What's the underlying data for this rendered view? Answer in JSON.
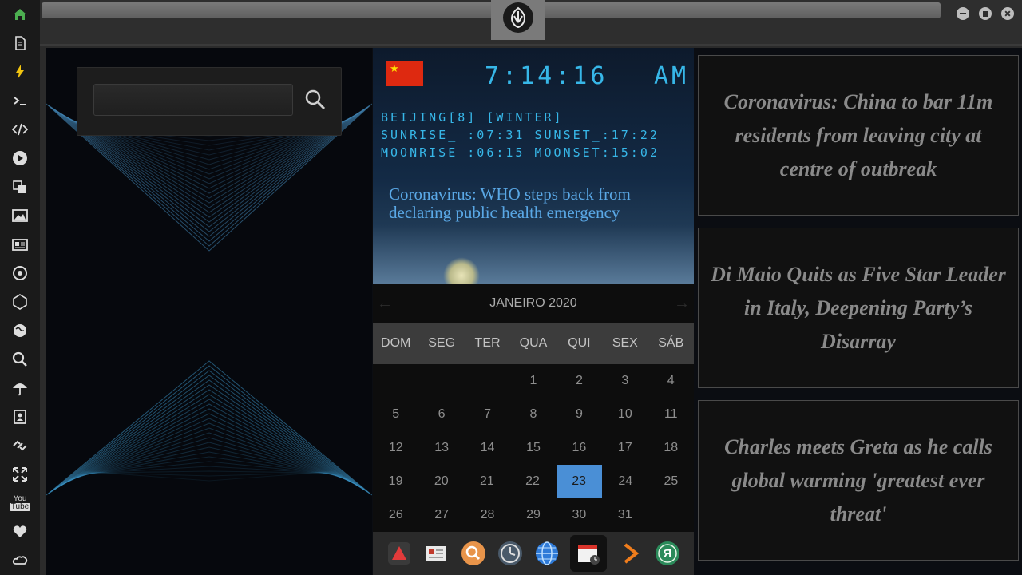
{
  "sidebar": {
    "icons": [
      "home-icon",
      "document-icon",
      "bolt-icon",
      "terminal-icon",
      "code-icon",
      "play-icon",
      "translate-icon",
      "image-icon",
      "news-icon",
      "rebel-icon",
      "network-icon",
      "globe-icon",
      "search-icon",
      "umbrella-icon",
      "contacts-icon",
      "link-icon",
      "expand-icon",
      "youtube-icon",
      "heart-icon",
      "cloud-icon"
    ],
    "youtube_label": "You Tube"
  },
  "weather": {
    "time": "7:14:16",
    "ampm": "AM",
    "location_line": "BEIJING[8] [WINTER]",
    "sun_line": "SUNRISE_ :07:31 SUNSET_:17:22",
    "moon_line": "MOONRISE :06:15 MOONSET:15:02",
    "headline": "Coronavirus: WHO steps back from declaring public health emergency",
    "flag_star": "★"
  },
  "calendar": {
    "prev": "←",
    "next": "→",
    "month": "JANEIRO 2020",
    "days_of_week": [
      "DOM",
      "SEG",
      "TER",
      "QUA",
      "QUI",
      "SEX",
      "SÁB"
    ],
    "weeks": [
      [
        "",
        "",
        "",
        "1",
        "2",
        "3",
        "4"
      ],
      [
        "5",
        "6",
        "7",
        "8",
        "9",
        "10",
        "11"
      ],
      [
        "12",
        "13",
        "14",
        "15",
        "16",
        "17",
        "18"
      ],
      [
        "19",
        "20",
        "21",
        "22",
        "23",
        "24",
        "25"
      ],
      [
        "26",
        "27",
        "28",
        "29",
        "30",
        "31",
        ""
      ]
    ],
    "today": "23"
  },
  "dock": {
    "items": [
      "app-a-icon",
      "news-reader-icon",
      "search-app-icon",
      "clock-app-icon",
      "browser-icon",
      "calendar-app-icon",
      "play-arrow-icon",
      "yandex-icon"
    ],
    "active": "calendar-app-icon",
    "yandex_letter": "Я"
  },
  "news": [
    "Coronavirus: China to bar 11m residents from leaving city at centre of outbreak",
    "Di Maio Quits as Five Star Leader in Italy, Deepening Party’s Disarray",
    "Charles meets Greta as he calls global warming 'greatest ever threat'"
  ],
  "colors": {
    "accent": "#37b7e8",
    "today": "#4a8fd6",
    "home": "#4caf50"
  }
}
